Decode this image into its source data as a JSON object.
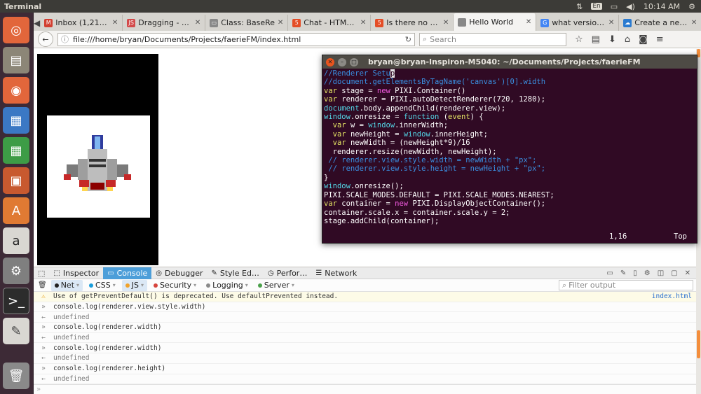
{
  "system": {
    "app_title": "Terminal",
    "keyboard_lang": "En",
    "clock": "10:14 AM"
  },
  "launcher": {
    "items": [
      "ubuntu-dash-icon",
      "files-icon",
      "firefox-icon",
      "writer-icon",
      "calc-icon",
      "impress-icon",
      "software-center-icon",
      "amazon-icon",
      "settings-icon",
      "terminal-icon",
      "text-editor-icon",
      "trash-icon"
    ]
  },
  "tabs": [
    {
      "label": "Inbox (1,21…",
      "icon": "gmail-icon",
      "color": "#d23f31",
      "glyph": "M"
    },
    {
      "label": "Dragging - …",
      "icon": "js-icon",
      "color": "#d34a4a",
      "glyph": "JS"
    },
    {
      "label": "Class: BaseRen…",
      "icon": "page-icon",
      "color": "#888888",
      "glyph": "▭"
    },
    {
      "label": "Chat - HTM…",
      "icon": "html5-icon",
      "color": "#e44d26",
      "glyph": "5"
    },
    {
      "label": "Is there no …",
      "icon": "html5-icon",
      "color": "#e44d26",
      "glyph": "5"
    },
    {
      "label": "Hello World",
      "icon": "page-icon",
      "color": "#888888",
      "glyph": ""
    },
    {
      "label": "what versio…",
      "icon": "google-icon",
      "color": "#4285f4",
      "glyph": "G"
    },
    {
      "label": "Create a ne…",
      "icon": "cloud-icon",
      "color": "#2b7bd0",
      "glyph": "☁"
    }
  ],
  "navbar": {
    "url": "file:///home/bryan/Documents/Projects/faerieFM/index.html",
    "search_placeholder": "Search"
  },
  "terminal": {
    "title": "bryan@bryan-Inspiron-M5040: ~/Documents/Projects/faerieFM",
    "status_position": "1,16",
    "status_scroll": "Top"
  },
  "devtools": {
    "tabs": [
      {
        "label": "Inspector",
        "icon": "inspector-icon",
        "active": false
      },
      {
        "label": "Console",
        "icon": "console-icon",
        "active": true
      },
      {
        "label": "Debugger",
        "icon": "debugger-icon",
        "active": false
      },
      {
        "label": "Style Ed…",
        "icon": "style-editor-icon",
        "active": false
      },
      {
        "label": "Perfor…",
        "icon": "performance-icon",
        "active": false
      },
      {
        "label": "Network",
        "icon": "network-icon",
        "active": false
      }
    ],
    "filters": [
      {
        "label": "Net",
        "color": "#222222",
        "on": true
      },
      {
        "label": "CSS",
        "color": "#1a9ddb",
        "on": false
      },
      {
        "label": "JS",
        "color": "#f0a22b",
        "on": true
      },
      {
        "label": "Security",
        "color": "#d6443c",
        "on": false
      },
      {
        "label": "Logging",
        "color": "#8a8a8a",
        "on": false
      },
      {
        "label": "Server",
        "color": "#4aa04a",
        "on": false
      }
    ],
    "filter_placeholder": "Filter output",
    "log": [
      {
        "kind": "warn",
        "gutter": "⚠",
        "text": "Use of getPreventDefault() is deprecated.  Use defaultPrevented instead.",
        "source": "index.html"
      },
      {
        "kind": "input",
        "gutter": "»",
        "text": "console.log(renderer.view.style.width)",
        "source": ""
      },
      {
        "kind": "res",
        "gutter": "←",
        "text": "undefined",
        "source": ""
      },
      {
        "kind": "input",
        "gutter": "»",
        "text": "console.log(renderer.width)",
        "source": ""
      },
      {
        "kind": "res",
        "gutter": "←",
        "text": "undefined",
        "source": ""
      },
      {
        "kind": "input",
        "gutter": "»",
        "text": "console.log(renderer.width)",
        "source": ""
      },
      {
        "kind": "res",
        "gutter": "←",
        "text": "undefined",
        "source": ""
      },
      {
        "kind": "input",
        "gutter": "»",
        "text": "console.log(renderer.height)",
        "source": ""
      },
      {
        "kind": "res",
        "gutter": "←",
        "text": "undefined",
        "source": ""
      }
    ],
    "prompt": "»"
  }
}
